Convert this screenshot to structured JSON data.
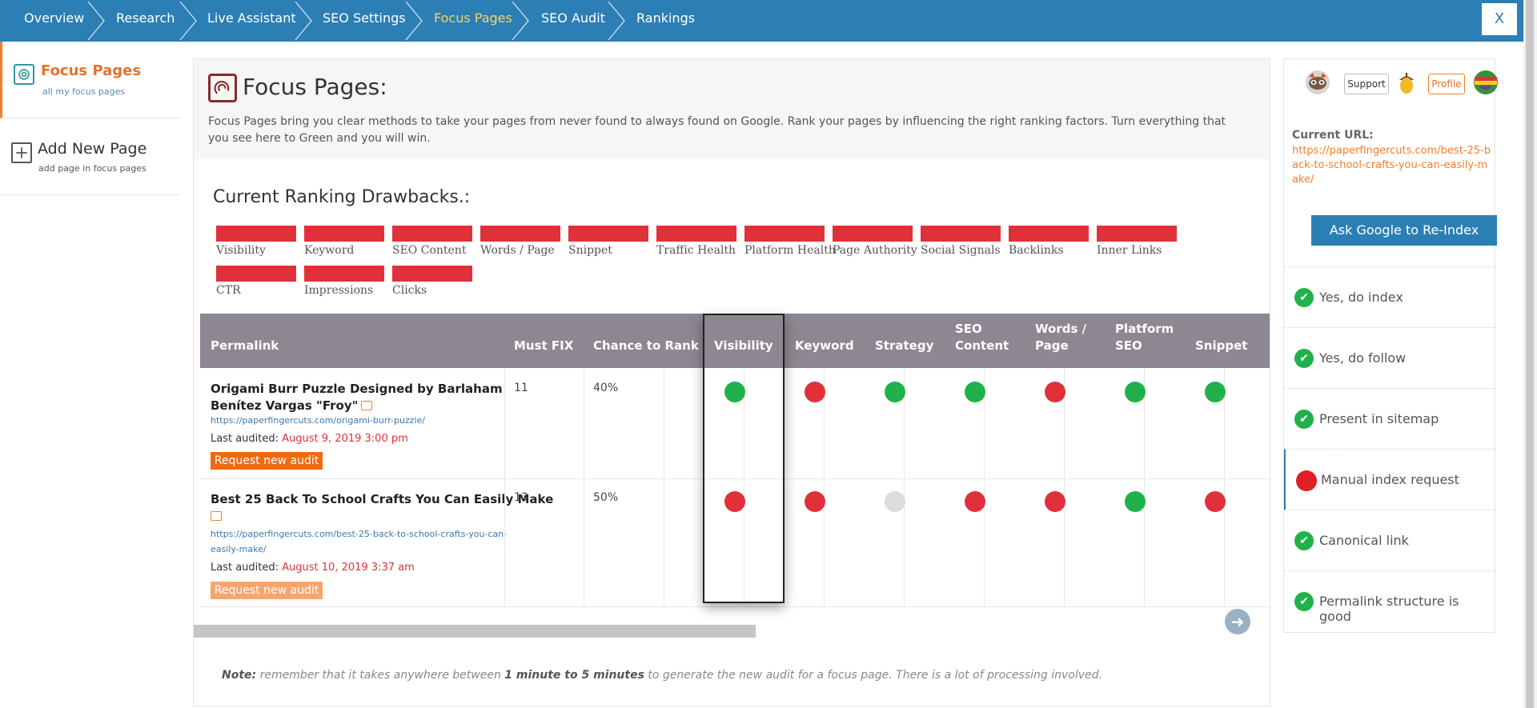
{
  "nav": {
    "items": [
      {
        "label": "Overview",
        "active": false
      },
      {
        "label": "Research",
        "active": false
      },
      {
        "label": "Live Assistant",
        "active": false
      },
      {
        "label": "SEO Settings",
        "active": false
      },
      {
        "label": "Focus Pages",
        "active": true
      },
      {
        "label": "SEO Audit",
        "active": false
      },
      {
        "label": "Rankings",
        "active": false
      }
    ],
    "close_label": "X",
    "colors": {
      "bar": "#2c7fb4",
      "active": "#f5d26a"
    }
  },
  "sidebar": {
    "focus": {
      "title": "Focus Pages",
      "subtitle": "all my focus pages",
      "icon": "focus-pages-icon"
    },
    "add": {
      "title": "Add New Page",
      "subtitle": "add page in focus pages",
      "icon": "plus-square-icon"
    }
  },
  "main": {
    "title": "Focus Pages:",
    "description": "Focus Pages bring you clear methods to take your pages from never found to always found on Google. Rank your pages by influencing the right ranking factors. Turn everything that you see here to Green and you will win.",
    "drawbacks_title": "Current Ranking Drawbacks.:",
    "drawbacks": [
      "Visibility",
      "Keyword",
      "SEO Content",
      "Words / Page",
      "Snippet",
      "Traffic Health",
      "Platform Health",
      "Page Authority",
      "Social Signals",
      "Backlinks",
      "Inner Links",
      "CTR",
      "Impressions",
      "Clicks"
    ],
    "table": {
      "headers": {
        "permalink": "Permalink",
        "must_fix": "Must FIX",
        "chance": "Chance to Rank",
        "visibility": "Visibility",
        "keyword": "Keyword",
        "strategy": "Strategy",
        "seo_content_1": "SEO",
        "seo_content_2": "Content",
        "words_page_1": "Words /",
        "words_page_2": "Page",
        "platform_seo_1": "Platform",
        "platform_seo_2": "SEO",
        "snippet": "Snippet"
      },
      "rows": [
        {
          "title_line1": "Origami Burr Puzzle Designed by Barlaham",
          "title_line2": "Benítez Vargas \"Froy\"",
          "url": "https://paperfingercuts.com/origami-burr-puzzle/",
          "audited_label": "Last audited:",
          "audited_date": "August 9, 2019 3:00 pm",
          "button": "Request new audit",
          "must_fix": "11",
          "chance": "40%",
          "statuses": [
            "green",
            "red",
            "green",
            "green",
            "red",
            "green",
            "green"
          ]
        },
        {
          "title_line1": "Best 25 Back To School Crafts You Can Easily Make",
          "url_line1": "https://paperfingercuts.com/best-25-back-to-school-crafts-you-can-",
          "url_line2": "easily-make/",
          "audited_label": "Last audited:",
          "audited_date": "August 10, 2019 3:37 am",
          "button": "Request new audit",
          "must_fix": "13",
          "chance": "50%",
          "statuses": [
            "red",
            "red",
            "grey",
            "red",
            "red",
            "green",
            "red"
          ]
        }
      ]
    },
    "note_label": "Note:",
    "note_a": "remember that it takes anywhere between",
    "note_b": "1 minute to 5 minutes",
    "note_c": "to generate the new audit for a focus page. There is a lot of processing involved.",
    "next_icon": "arrow-right-circle-icon"
  },
  "right": {
    "support_label": "Support",
    "profile_label": "Profile",
    "current_url_label": "Current URL:",
    "current_url": "https://paperfingercuts.com/best-25-back-to-school-crafts-you-can-easily-make/",
    "reindex_label": "Ask Google to Re-Index",
    "checks": [
      {
        "label": "Yes, do index",
        "ok": true
      },
      {
        "label": "Yes, do follow",
        "ok": true
      },
      {
        "label": "Present in sitemap",
        "ok": true
      },
      {
        "label": "Manual index request",
        "ok": false
      },
      {
        "label": "Canonical link",
        "ok": true
      },
      {
        "label": "Permalink structure is good",
        "ok": true
      }
    ]
  }
}
